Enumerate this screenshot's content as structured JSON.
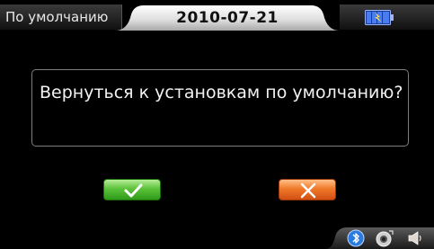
{
  "header": {
    "mode_label": "По умолчанию",
    "date": "2010-07-21"
  },
  "dialog": {
    "message": "Вернуться к установкам по умолчанию?"
  },
  "buttons": {
    "confirm_icon": "checkmark-icon",
    "cancel_icon": "cross-icon"
  },
  "tray": {
    "icons": [
      "bluetooth-icon",
      "camera-icon",
      "speaker-icon"
    ]
  },
  "colors": {
    "confirm": "#5cc23a",
    "cancel": "#f07a2a",
    "battery": "#4a7cf0"
  }
}
